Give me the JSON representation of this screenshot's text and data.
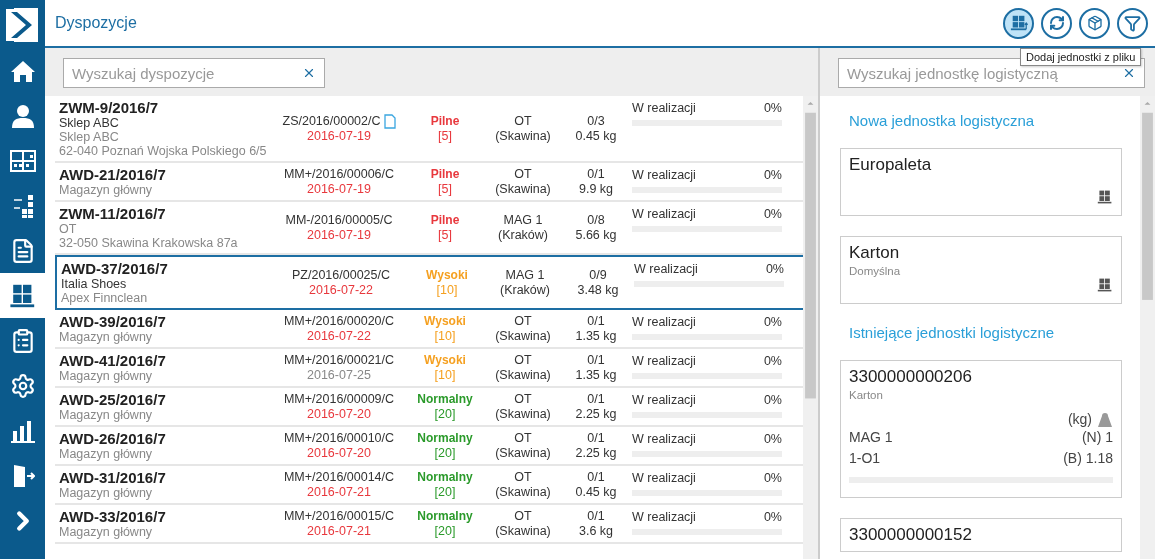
{
  "header": {
    "title": "Dyspozycje"
  },
  "nav_items": [
    {
      "selected": false
    },
    {
      "selected": false
    },
    {
      "selected": false
    },
    {
      "selected": false
    },
    {
      "selected": false
    },
    {
      "selected": true
    },
    {
      "selected": false
    },
    {
      "selected": false
    },
    {
      "selected": false
    },
    {
      "selected": false
    },
    {
      "selected": false
    }
  ],
  "toolbar": {
    "buttons": [
      {
        "selected": true
      },
      {
        "selected": false
      },
      {
        "selected": false
      },
      {
        "selected": false
      }
    ],
    "tooltip": "Dodaj jednostki z pliku"
  },
  "orders": {
    "search": {
      "placeholder": "Wyszukaj dyspozycje"
    },
    "rows": [
      {
        "number": "ZWM-9/2016/7",
        "lines": [
          {
            "text": "Sklep ABC",
            "kind": "primary"
          },
          {
            "text": "Sklep ABC",
            "kind": "secondary"
          },
          {
            "text": "62-040 Poznań Wojska Polskiego 6/5",
            "kind": "secondary"
          }
        ],
        "document": "ZS/2016/00002/C",
        "attachment": true,
        "date": "2016-07-19",
        "overdue": true,
        "priority": {
          "label": "Pilne",
          "count": "[5]",
          "kind": "urgent"
        },
        "warehouse": "OT",
        "location": "(Skawina)",
        "quantity": "0/3",
        "weight": "0.45 kg",
        "status": "W realizacji",
        "percent": "0%",
        "level": 0,
        "selected": false
      },
      {
        "number": "AWD-21/2016/7",
        "lines": [
          {
            "text": "Magazyn główny",
            "kind": "secondary"
          }
        ],
        "document": "MM+/2016/00006/C",
        "attachment": false,
        "date": "2016-07-19",
        "overdue": true,
        "priority": {
          "label": "Pilne",
          "count": "[5]",
          "kind": "urgent"
        },
        "warehouse": "OT",
        "location": "(Skawina)",
        "quantity": "0/1",
        "weight": "9.9 kg",
        "status": "W realizacji",
        "percent": "0%",
        "level": 0,
        "selected": false
      },
      {
        "number": "ZWM-11/2016/7",
        "lines": [
          {
            "text": "OT",
            "kind": "secondary"
          },
          {
            "text": "32-050 Skawina Krakowska 87a",
            "kind": "secondary"
          }
        ],
        "document": "MM-/2016/00005/C",
        "attachment": false,
        "date": "2016-07-19",
        "overdue": true,
        "priority": {
          "label": "Pilne",
          "count": "[5]",
          "kind": "urgent"
        },
        "warehouse": "MAG 1",
        "location": "(Kraków)",
        "quantity": "0/8",
        "weight": "5.66 kg",
        "status": "W realizacji",
        "percent": "0%",
        "level": 0,
        "selected": false
      },
      {
        "number": "AWD-37/2016/7",
        "lines": [
          {
            "text": "Italia Shoes",
            "kind": "primary"
          },
          {
            "text": "Apex Finnclean",
            "kind": "secondary"
          }
        ],
        "document": "PZ/2016/00025/C",
        "attachment": false,
        "date": "2016-07-22",
        "overdue": true,
        "priority": {
          "label": "Wysoki",
          "count": "[10]",
          "kind": "high"
        },
        "warehouse": "MAG 1",
        "location": "(Kraków)",
        "quantity": "0/9",
        "weight": "3.48 kg",
        "status": "W realizacji",
        "percent": "0%",
        "level": 0,
        "selected": true
      },
      {
        "number": "AWD-39/2016/7",
        "lines": [
          {
            "text": "Magazyn główny",
            "kind": "secondary"
          }
        ],
        "document": "MM+/2016/00020/C",
        "attachment": false,
        "date": "2016-07-22",
        "overdue": true,
        "priority": {
          "label": "Wysoki",
          "count": "[10]",
          "kind": "high"
        },
        "warehouse": "OT",
        "location": "(Skawina)",
        "quantity": "0/1",
        "weight": "1.35 kg",
        "status": "W realizacji",
        "percent": "0%",
        "level": 0,
        "selected": false
      },
      {
        "number": "AWD-41/2016/7",
        "lines": [
          {
            "text": "Magazyn główny",
            "kind": "secondary"
          }
        ],
        "document": "MM+/2016/00021/C",
        "attachment": false,
        "date": "2016-07-25",
        "overdue": false,
        "priority": {
          "label": "Wysoki",
          "count": "[10]",
          "kind": "high"
        },
        "warehouse": "OT",
        "location": "(Skawina)",
        "quantity": "0/1",
        "weight": "1.35 kg",
        "status": "W realizacji",
        "percent": "0%",
        "level": 0,
        "selected": false
      },
      {
        "number": "AWD-25/2016/7",
        "lines": [
          {
            "text": "Magazyn główny",
            "kind": "secondary"
          }
        ],
        "document": "MM+/2016/00009/C",
        "attachment": false,
        "date": "2016-07-20",
        "overdue": true,
        "priority": {
          "label": "Normalny",
          "count": "[20]",
          "kind": "normal"
        },
        "warehouse": "OT",
        "location": "(Skawina)",
        "quantity": "0/1",
        "weight": "2.25 kg",
        "status": "W realizacji",
        "percent": "0%",
        "level": 0,
        "selected": false
      },
      {
        "number": "AWD-26/2016/7",
        "lines": [
          {
            "text": "Magazyn główny",
            "kind": "secondary"
          }
        ],
        "document": "MM+/2016/00010/C",
        "attachment": false,
        "date": "2016-07-20",
        "overdue": true,
        "priority": {
          "label": "Normalny",
          "count": "[20]",
          "kind": "normal"
        },
        "warehouse": "OT",
        "location": "(Skawina)",
        "quantity": "0/1",
        "weight": "2.25 kg",
        "status": "W realizacji",
        "percent": "0%",
        "level": 0,
        "selected": false
      },
      {
        "number": "AWD-31/2016/7",
        "lines": [
          {
            "text": "Magazyn główny",
            "kind": "secondary"
          }
        ],
        "document": "MM+/2016/00014/C",
        "attachment": false,
        "date": "2016-07-21",
        "overdue": true,
        "priority": {
          "label": "Normalny",
          "count": "[20]",
          "kind": "normal"
        },
        "warehouse": "OT",
        "location": "(Skawina)",
        "quantity": "0/1",
        "weight": "0.45 kg",
        "status": "W realizacji",
        "percent": "0%",
        "level": 0,
        "selected": false
      },
      {
        "number": "AWD-33/2016/7",
        "lines": [
          {
            "text": "Magazyn główny",
            "kind": "secondary"
          }
        ],
        "document": "MM+/2016/00015/C",
        "attachment": false,
        "date": "2016-07-21",
        "overdue": true,
        "priority": {
          "label": "Normalny",
          "count": "[20]",
          "kind": "normal"
        },
        "warehouse": "OT",
        "location": "(Skawina)",
        "quantity": "0/1",
        "weight": "3.6 kg",
        "status": "W realizacji",
        "percent": "0%",
        "level": 0,
        "selected": false
      }
    ]
  },
  "units": {
    "search": {
      "placeholder": "Wyszukaj jednostkę logistyczną"
    },
    "new_heading": "Nowa jednostka logistyczna",
    "new_units": [
      {
        "name": "Europaleta"
      },
      {
        "name": "Karton",
        "subtitle": "Domyślna"
      }
    ],
    "existing_heading": "Istniejące jednostki logistyczne",
    "existing_units": [
      {
        "code": "3300000000206",
        "type": "Karton",
        "weight_unit": "(kg)",
        "warehouse": "MAG 1",
        "net": "(N) 1",
        "location": "1-O1",
        "gross": "(B) 1.18",
        "level": 0
      },
      {
        "code": "3300000000152"
      }
    ]
  }
}
